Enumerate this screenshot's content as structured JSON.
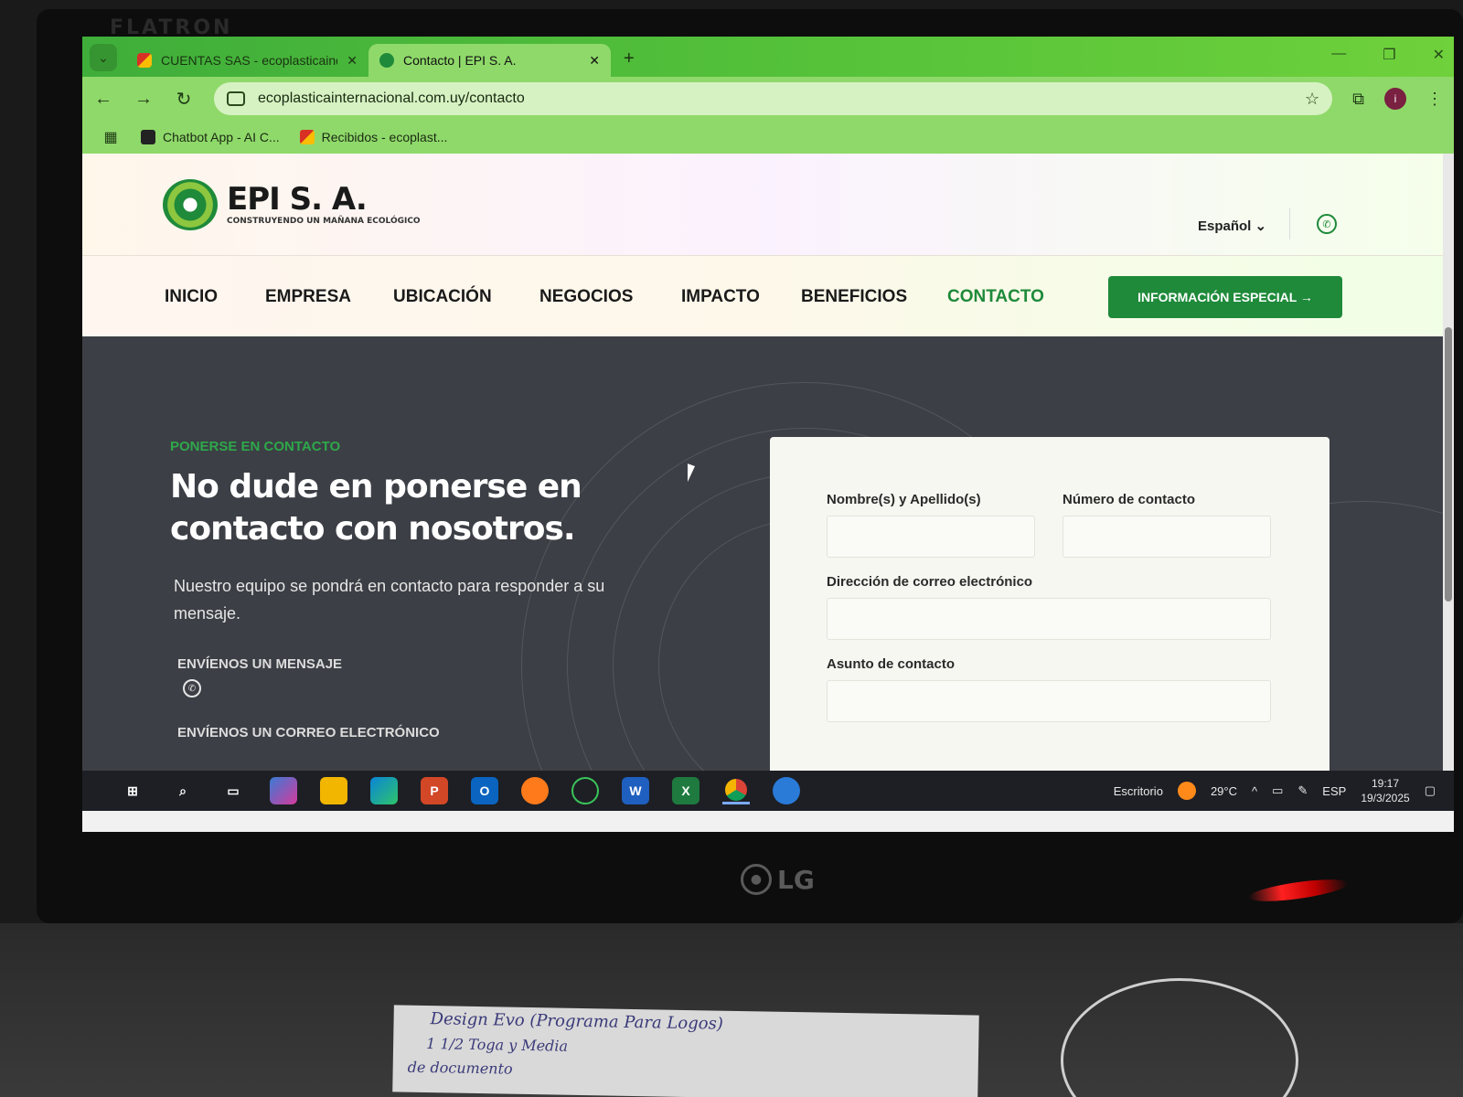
{
  "monitor": {
    "top_brand": "FLATRON",
    "bottom_brand": "LG"
  },
  "browser": {
    "tabs": [
      {
        "title": "CUENTAS SAS - ecoplasticaind",
        "active": false
      },
      {
        "title": "Contacto | EPI S. A.",
        "active": true
      }
    ],
    "url": "ecoplasticainternacional.com.uy/contacto",
    "bookmarks": [
      {
        "label": "Chatbot App - AI C..."
      },
      {
        "label": "Recibidos - ecoplast..."
      }
    ]
  },
  "site": {
    "logo_name": "EPI S. A.",
    "logo_tagline": "CONSTRUYENDO UN MAÑANA ECOLÓGICO",
    "language": "Español ⌄",
    "nav": [
      "INICIO",
      "EMPRESA",
      "UBICACIÓN",
      "NEGOCIOS",
      "IMPACTO",
      "BENEFICIOS",
      "CONTACTO"
    ],
    "active_nav": "CONTACTO",
    "cta_label": "INFORMACIÓN ESPECIAL →"
  },
  "hero": {
    "kicker": "PONERSE EN CONTACTO",
    "heading": "No dude en ponerse en contacto con nosotros.",
    "lead": "Nuestro equipo se pondrá en contacto para responder a su mensaje.",
    "message_label": "ENVÍENOS UN MENSAJE",
    "email_label": "ENVÍENOS UN CORREO ELECTRÓNICO"
  },
  "form": {
    "name_label": "Nombre(s) y Apellido(s)",
    "phone_label": "Número de contacto",
    "email_label": "Dirección de correo electrónico",
    "subject_label": "Asunto de contacto"
  },
  "taskbar": {
    "desktop_label": "Escritorio",
    "temperature": "29°C",
    "language": "ESP",
    "time": "19:17",
    "date": "19/3/2025"
  },
  "desk_note": {
    "line1": "Design Evo (Programa Para Logos)",
    "line2": "1 1/2 Toga y Media",
    "line3": "de documento"
  },
  "colors": {
    "accent": "#1e8a3a",
    "browser_green": "#58c43a",
    "hero_bg": "#3c3f45"
  }
}
